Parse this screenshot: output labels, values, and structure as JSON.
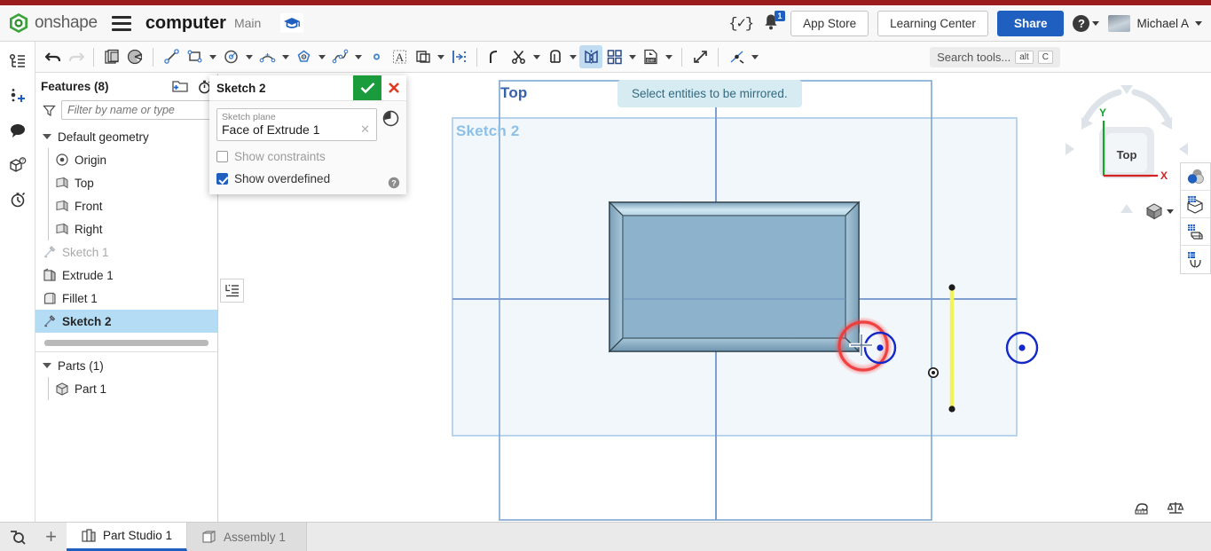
{
  "header": {
    "brand": "onshape",
    "logo_icon": "onshape-logo-icon",
    "menu_icon": "hamburger-menu-icon",
    "document_title": "computer",
    "branch": "Main",
    "graduation_icon": "graduation-cap-icon",
    "featurescript_icon": "featurescript-braces-icon",
    "bell_icon": "notification-bell-icon",
    "notification_count": "1",
    "app_store": "App Store",
    "learning_center": "Learning Center",
    "share": "Share",
    "help_icon": "help-question-icon",
    "help_caret_icon": "chevron-down-icon",
    "avatar_icon": "user-avatar",
    "user_name": "Michael A",
    "user_caret_icon": "chevron-down-icon"
  },
  "left_rail": [
    {
      "name": "feature-list-icon",
      "title": "Feature list"
    },
    {
      "name": "add-part-icon",
      "title": "Insert"
    },
    {
      "name": "comments-icon",
      "title": "Comments"
    },
    {
      "name": "part-info-icon",
      "title": "Part information"
    },
    {
      "name": "history-icon",
      "title": "History"
    }
  ],
  "toolbar": {
    "items": [
      {
        "name": "undo-icon",
        "caret": false,
        "active": false,
        "disabled": false
      },
      {
        "name": "redo-icon",
        "caret": false,
        "active": false,
        "disabled": true
      },
      {
        "sep": true
      },
      {
        "name": "new-sketch-icon",
        "caret": false,
        "active": false,
        "disabled": false
      },
      {
        "name": "plane-icon",
        "caret": false,
        "active": false,
        "disabled": false
      },
      {
        "sep": true
      },
      {
        "name": "line-icon",
        "caret": false,
        "active": false,
        "disabled": false
      },
      {
        "name": "rectangle-icon",
        "caret": true,
        "active": false,
        "disabled": false
      },
      {
        "name": "circle-icon",
        "caret": true,
        "active": false,
        "disabled": false
      },
      {
        "name": "arc-icon",
        "caret": true,
        "active": false,
        "disabled": false
      },
      {
        "name": "polygon-icon",
        "caret": true,
        "active": false,
        "disabled": false
      },
      {
        "name": "spline-icon",
        "caret": true,
        "active": false,
        "disabled": false
      },
      {
        "name": "point-icon",
        "caret": false,
        "active": false,
        "disabled": false
      },
      {
        "name": "text-icon",
        "caret": false,
        "active": false,
        "disabled": false
      },
      {
        "name": "offset-icon",
        "caret": true,
        "active": false,
        "disabled": false
      },
      {
        "name": "dimension-icon",
        "caret": false,
        "active": false,
        "disabled": false
      },
      {
        "sep": true
      },
      {
        "name": "fillet-icon",
        "caret": false,
        "active": false,
        "disabled": false
      },
      {
        "name": "trim-icon",
        "caret": true,
        "active": false,
        "disabled": false
      },
      {
        "name": "extend-icon",
        "caret": true,
        "active": false,
        "disabled": false
      },
      {
        "name": "mirror-icon",
        "caret": false,
        "active": true,
        "disabled": false
      },
      {
        "name": "linear-pattern-icon",
        "caret": true,
        "active": false,
        "disabled": false
      },
      {
        "name": "dxf-import-icon",
        "caret": true,
        "active": false,
        "disabled": false
      },
      {
        "sep": true
      },
      {
        "name": "transform-icon",
        "caret": false,
        "active": false,
        "disabled": false
      },
      {
        "sep": true
      },
      {
        "name": "construction-icon",
        "caret": true,
        "active": false,
        "disabled": false
      }
    ],
    "search_label": "Search tools...",
    "search_key_alt": "alt",
    "search_key_c": "C"
  },
  "feature_tree": {
    "title": "Features (8)",
    "new_folder_icon": "new-folder-icon",
    "rollback_icon": "rollback-timer-icon",
    "filter_icon": "filter-funnel-icon",
    "filter_placeholder": "Filter by name or type",
    "items": [
      {
        "label": "Default geometry",
        "icon": "chevron-down-icon",
        "level": 0,
        "state": "normal"
      },
      {
        "label": "Origin",
        "icon": "origin-icon",
        "level": 1,
        "state": "normal"
      },
      {
        "label": "Top",
        "icon": "plane-icon",
        "level": 1,
        "state": "normal"
      },
      {
        "label": "Front",
        "icon": "plane-icon",
        "level": 1,
        "state": "normal"
      },
      {
        "label": "Right",
        "icon": "plane-icon",
        "level": 1,
        "state": "normal"
      },
      {
        "label": "Sketch 1",
        "icon": "sketch-icon",
        "level": 0,
        "state": "dimmed"
      },
      {
        "label": "Extrude 1",
        "icon": "extrude-icon",
        "level": 0,
        "state": "normal"
      },
      {
        "label": "Fillet 1",
        "icon": "fillet-feature-icon",
        "level": 0,
        "state": "normal"
      },
      {
        "label": "Sketch 2",
        "icon": "sketch-icon",
        "level": 0,
        "state": "selected"
      }
    ],
    "parts_header": "Parts (1)",
    "parts_chevron_icon": "chevron-down-icon",
    "parts": [
      {
        "label": "Part 1",
        "icon": "part-icon"
      }
    ]
  },
  "sketch_dialog": {
    "title": "Sketch 2",
    "ok_icon": "checkmark-icon",
    "cancel_icon": "close-x-icon",
    "clock_icon": "sketch-history-icon",
    "plane_label": "Sketch plane",
    "plane_value": "Face of Extrude 1",
    "plane_clear_icon": "clear-x-icon",
    "show_constraints_label": "Show constraints",
    "show_constraints_checked": false,
    "show_overdefined_label": "Show overdefined",
    "show_overdefined_checked": true,
    "help_icon": "help-question-icon",
    "panel_mini_icon": "feature-list-panel-icon"
  },
  "viewport": {
    "tooltip": "Select entities to be mirrored.",
    "plane_label": "Top",
    "sketch_label": "Sketch 2",
    "colors": {
      "sketch_entity": "#1428c8",
      "overdefined": "#ee3a3a",
      "mirror_line_selected": "#f2f25a",
      "plane_border": "#7aa8d8",
      "sketch_region": "#9fd0f0"
    },
    "view_cube": {
      "face_label": "Top",
      "axis_x": "X",
      "axis_y": "Y",
      "x_color": "#d32222",
      "y_color": "#19a22e",
      "cube_menu_icon": "view-cube-menu-icon",
      "cube_caret_icon": "chevron-down-icon"
    },
    "right_tools": [
      {
        "name": "appearance-icon"
      },
      {
        "name": "display-state-icon"
      },
      {
        "name": "section-view-icon"
      },
      {
        "name": "render-mode-icon"
      }
    ],
    "bottom_icons": [
      {
        "name": "measure-tape-icon"
      },
      {
        "name": "mass-properties-icon"
      }
    ]
  },
  "tabbar": {
    "zoom_icon": "zoom-search-icon",
    "add_tab_icon": "add-tab-plus-icon",
    "tabs": [
      {
        "label": "Part Studio 1",
        "icon": "part-studio-icon",
        "active": true
      },
      {
        "label": "Assembly 1",
        "icon": "assembly-icon",
        "active": false
      }
    ]
  }
}
